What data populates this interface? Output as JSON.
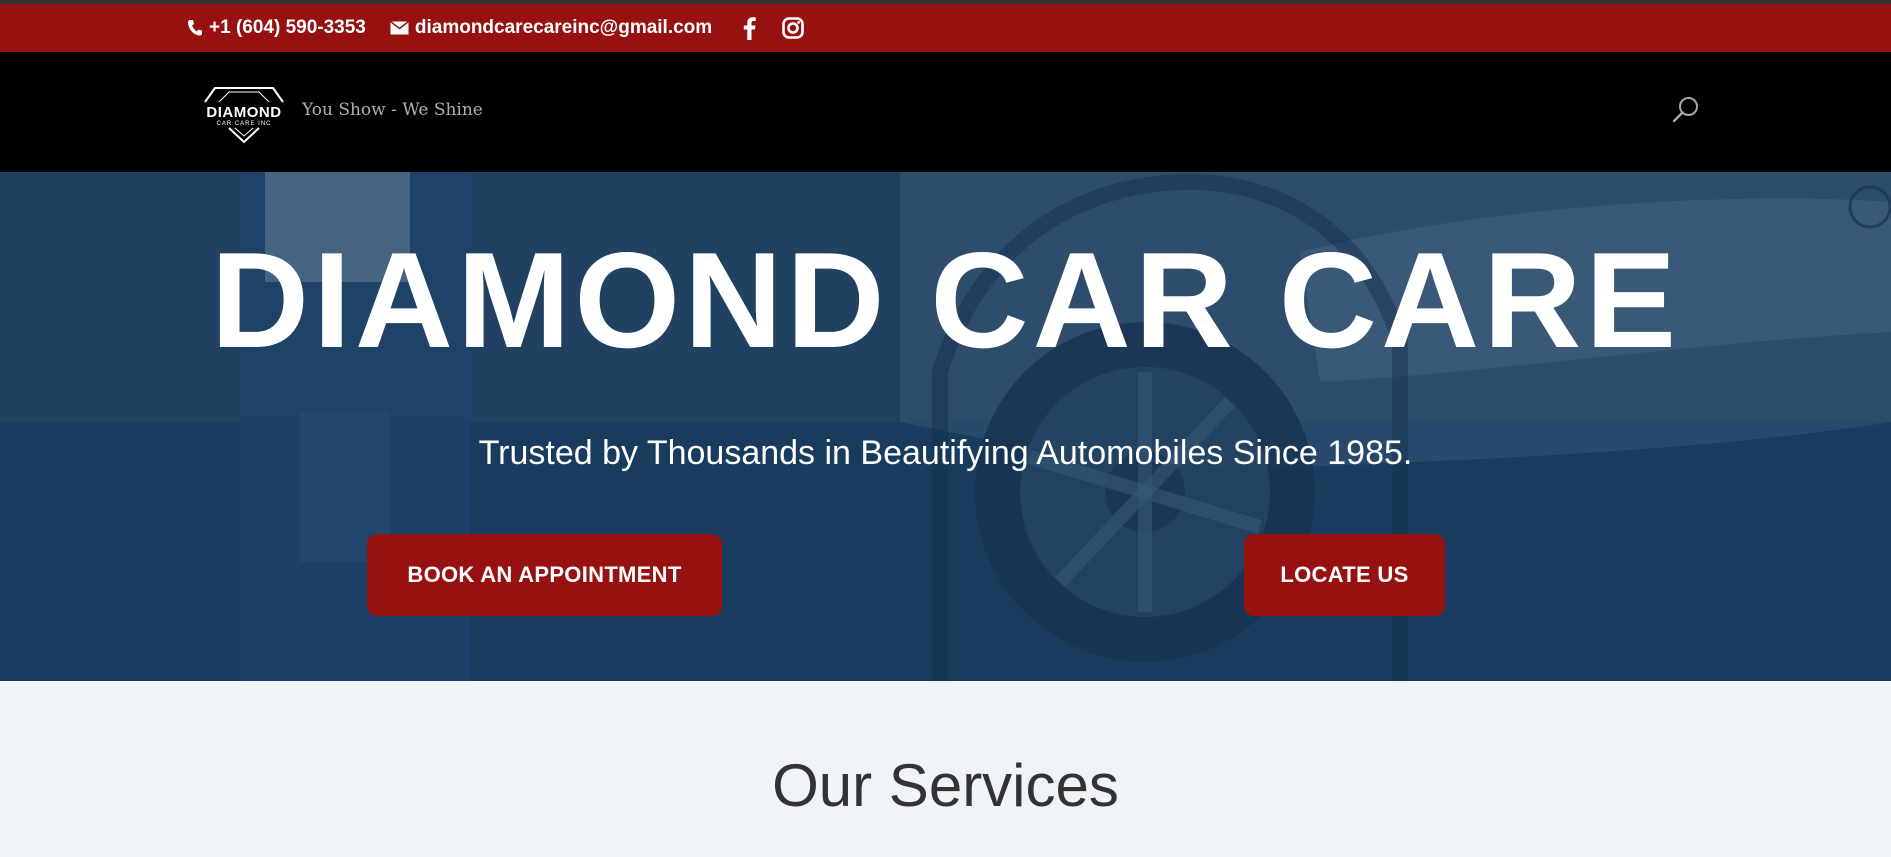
{
  "topbar": {
    "phone": "+1 (604) 590-3353",
    "email": "diamondcarecareinc@gmail.com",
    "social": [
      "facebook-icon",
      "instagram-icon"
    ]
  },
  "header": {
    "logo_text": "DIAMOND",
    "logo_subtext": "CAR CARE INC",
    "tagline": "You Show - We Shine",
    "search_icon": "search-icon"
  },
  "hero": {
    "title": "DIAMOND CAR CARE",
    "subtitle": "Trusted by Thousands in Beautifying Automobiles Since 1985.",
    "book_label": "BOOK AN APPOINTMENT",
    "locate_label": "LOCATE US"
  },
  "services": {
    "title": "Our Services"
  },
  "colors": {
    "brand_red": "#981111",
    "nav_black": "#000000",
    "hero_navy": "#163859",
    "page_bg": "#f0f4f8"
  }
}
